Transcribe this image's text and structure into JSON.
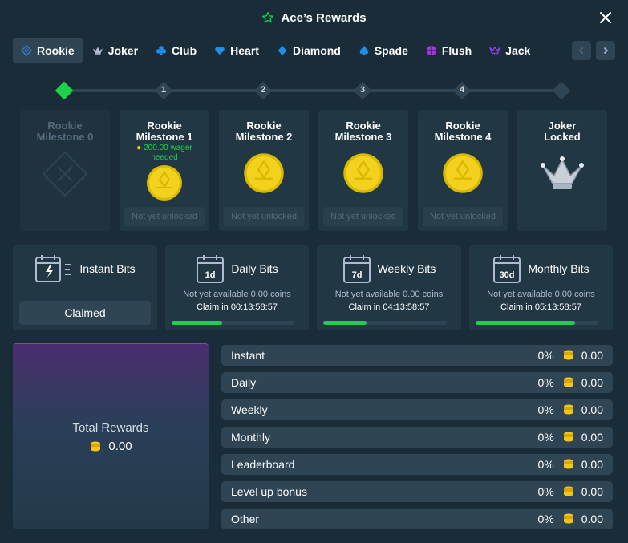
{
  "header": {
    "title": "Ace’s Rewards",
    "icon": "star-icon",
    "accent": "#1fd14a"
  },
  "tabs": [
    {
      "label": "Rookie",
      "icon": "rookie-diamond-icon",
      "color": "#2f7fd8",
      "active": true
    },
    {
      "label": "Joker",
      "icon": "joker-crown-icon",
      "color": "#b1bad3"
    },
    {
      "label": "Club",
      "icon": "club-icon",
      "color": "#1f8fe6"
    },
    {
      "label": "Heart",
      "icon": "heart-icon",
      "color": "#1f8fe6"
    },
    {
      "label": "Diamond",
      "icon": "diamond-icon",
      "color": "#1f8fe6"
    },
    {
      "label": "Spade",
      "icon": "spade-icon",
      "color": "#1f8fe6"
    },
    {
      "label": "Flush",
      "icon": "flush-icon",
      "color": "#a334e0"
    },
    {
      "label": "Jack",
      "icon": "jack-crown-icon",
      "color": "#8a3fe0"
    }
  ],
  "track": {
    "nodes": [
      {
        "label": "",
        "done": true
      },
      {
        "label": "1",
        "done": false
      },
      {
        "label": "2",
        "done": false
      },
      {
        "label": "3",
        "done": false
      },
      {
        "label": "4",
        "done": false
      },
      {
        "label": "",
        "done": false
      }
    ]
  },
  "milestones": [
    {
      "title_line1": "Rookie",
      "title_line2": "Milestone 0",
      "dim": true
    },
    {
      "title_line1": "Rookie",
      "title_line2": "Milestone 1",
      "wager_line1": "200.00 wager",
      "wager_line2": "needed",
      "status": "Not yet unlocked"
    },
    {
      "title_line1": "Rookie",
      "title_line2": "Milestone 2",
      "status": "Not yet unlocked"
    },
    {
      "title_line1": "Rookie",
      "title_line2": "Milestone 3",
      "status": "Not yet unlocked"
    },
    {
      "title_line1": "Rookie",
      "title_line2": "Milestone 4",
      "status": "Not yet unlocked"
    },
    {
      "title_line1": "Joker",
      "title_line2": "Locked"
    }
  ],
  "bits": {
    "instant": {
      "name": "Instant Bits",
      "button": "Claimed"
    },
    "daily": {
      "name": "Daily Bits",
      "badge": "1d",
      "sub": "Not yet available 0.00 coins",
      "claim": "Claim in 00:13:58:57",
      "progress": 0.41
    },
    "weekly": {
      "name": "Weekly Bits",
      "badge": "7d",
      "sub": "Not yet available 0.00 coins",
      "claim": "Claim in 04:13:58:57",
      "progress": 0.35
    },
    "monthly": {
      "name": "Monthly Bits",
      "badge": "30d",
      "sub": "Not yet available 0.00 coins",
      "claim": "Claim in 05:13:58:57",
      "progress": 0.81
    }
  },
  "total": {
    "title": "Total Rewards",
    "value": "0.00"
  },
  "rewards": [
    {
      "label": "Instant",
      "pct": "0%",
      "value": "0.00"
    },
    {
      "label": "Daily",
      "pct": "0%",
      "value": "0.00"
    },
    {
      "label": "Weekly",
      "pct": "0%",
      "value": "0.00"
    },
    {
      "label": "Monthly",
      "pct": "0%",
      "value": "0.00"
    },
    {
      "label": "Leaderboard",
      "pct": "0%",
      "value": "0.00"
    },
    {
      "label": "Level up bonus",
      "pct": "0%",
      "value": "0.00"
    },
    {
      "label": "Other",
      "pct": "0%",
      "value": "0.00"
    }
  ]
}
